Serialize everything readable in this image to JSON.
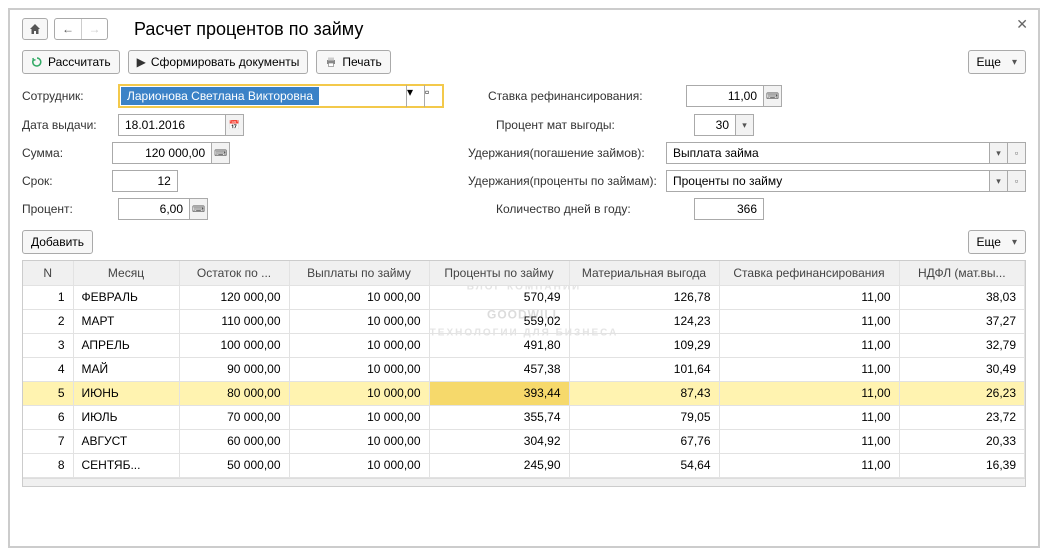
{
  "header": {
    "title": "Расчет процентов по займу"
  },
  "toolbar": {
    "calculate": "Рассчитать",
    "form_docs": "Сформировать документы",
    "print": "Печать",
    "more": "Еще"
  },
  "form": {
    "employee_label": "Сотрудник:",
    "employee_value": "Ларионова Светлана Викторовна",
    "issue_date_label": "Дата выдачи:",
    "issue_date": "18.01.2016",
    "amount_label": "Сумма:",
    "amount": "120 000,00",
    "term_label": "Срок:",
    "term": "12",
    "percent_label": "Процент:",
    "percent": "6,00",
    "refinance_label": "Ставка рефинансирования:",
    "refinance": "11,00",
    "matgain_label": "Процент мат выгоды:",
    "matgain": "30",
    "deduct_repay_label": "Удержания(погашение займов):",
    "deduct_repay": "Выплата займа",
    "deduct_interest_label": "Удержания(проценты по займам):",
    "deduct_interest": "Проценты по займу",
    "days_label": "Количество дней в году:",
    "days": "366"
  },
  "table_controls": {
    "add": "Добавить",
    "more": "Еще"
  },
  "columns": [
    "N",
    "Месяц",
    "Остаток по ...",
    "Выплаты по займу",
    "Проценты по займу",
    "Материальная выгода",
    "Ставка рефинансирования",
    "НДФЛ (мат.вы..."
  ],
  "rows": [
    {
      "n": "1",
      "month": "ФЕВРАЛЬ",
      "balance": "120 000,00",
      "payment": "10 000,00",
      "interest": "570,49",
      "gain": "126,78",
      "rate": "11,00",
      "tax": "38,03"
    },
    {
      "n": "2",
      "month": "МАРТ",
      "balance": "110 000,00",
      "payment": "10 000,00",
      "interest": "559,02",
      "gain": "124,23",
      "rate": "11,00",
      "tax": "37,27"
    },
    {
      "n": "3",
      "month": "АПРЕЛЬ",
      "balance": "100 000,00",
      "payment": "10 000,00",
      "interest": "491,80",
      "gain": "109,29",
      "rate": "11,00",
      "tax": "32,79"
    },
    {
      "n": "4",
      "month": "МАЙ",
      "balance": "90 000,00",
      "payment": "10 000,00",
      "interest": "457,38",
      "gain": "101,64",
      "rate": "11,00",
      "tax": "30,49"
    },
    {
      "n": "5",
      "month": "ИЮНЬ",
      "balance": "80 000,00",
      "payment": "10 000,00",
      "interest": "393,44",
      "gain": "87,43",
      "rate": "11,00",
      "tax": "26,23",
      "selected": true
    },
    {
      "n": "6",
      "month": "ИЮЛЬ",
      "balance": "70 000,00",
      "payment": "10 000,00",
      "interest": "355,74",
      "gain": "79,05",
      "rate": "11,00",
      "tax": "23,72"
    },
    {
      "n": "7",
      "month": "АВГУСТ",
      "balance": "60 000,00",
      "payment": "10 000,00",
      "interest": "304,92",
      "gain": "67,76",
      "rate": "11,00",
      "tax": "20,33"
    },
    {
      "n": "8",
      "month": "СЕНТЯБ...",
      "balance": "50 000,00",
      "payment": "10 000,00",
      "interest": "245,90",
      "gain": "54,64",
      "rate": "11,00",
      "tax": "16,39"
    }
  ],
  "watermark": {
    "top": "БЛОГ КОМПАНИИ",
    "main": "GOODWILL",
    "bottom": "ТЕХНОЛОГИИ ДЛЯ БИЗНЕСА"
  }
}
